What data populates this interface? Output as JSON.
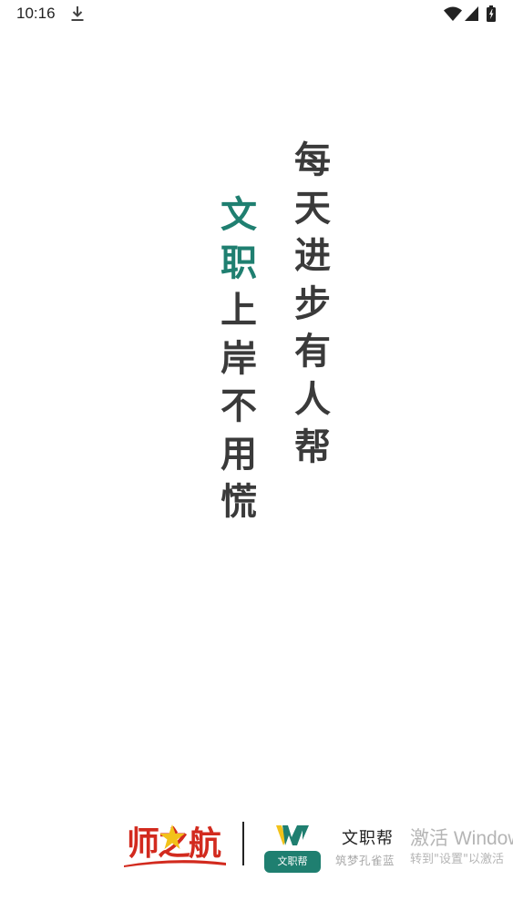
{
  "status_bar": {
    "time": "10:16",
    "icons": [
      "download-icon",
      "wifi-icon",
      "signal-icon",
      "battery-icon"
    ]
  },
  "slogan": {
    "right_column": [
      "每",
      "天",
      "进",
      "步",
      "有",
      "人",
      "帮"
    ],
    "left_column": [
      "文",
      "职",
      "上",
      "岸",
      "不",
      "用",
      "慌"
    ],
    "accent_count": 2
  },
  "branding": {
    "shizhihang_logo_text": "师之航",
    "wzb_badge": "文职帮",
    "wzb_name": "文职帮",
    "wzb_subtitle": "筑梦孔雀蓝",
    "activate_title": "激活 Windows",
    "activate_subtitle": "转到\"设置\"以激活"
  },
  "colors": {
    "accent": "#1f7f70",
    "text": "#3a3a3a",
    "brand_red": "#d22a1e",
    "brand_gold": "#f2c21a"
  }
}
